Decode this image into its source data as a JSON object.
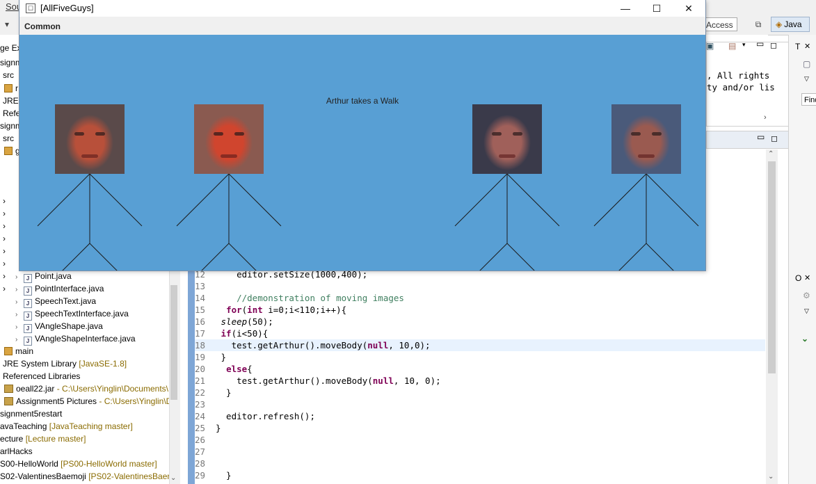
{
  "ide": {
    "menu_fragment": "Sou",
    "quick_access": "Access",
    "perspective": "Java",
    "find_box": "Find",
    "copyright_line1": ", All rights",
    "copyright_line2": "ty and/or lis"
  },
  "explorer": {
    "rows": [
      {
        "label": "ge Exp",
        "extra": ""
      },
      {
        "label": "signm",
        "extra": ""
      },
      {
        "label": "src",
        "extra": ""
      },
      {
        "label": "r",
        "extra": ""
      },
      {
        "label": "JRE S",
        "extra": ""
      },
      {
        "label": "Refe",
        "extra": ""
      },
      {
        "label": "signm",
        "extra": ""
      },
      {
        "label": "src",
        "extra": ""
      },
      {
        "label": "g",
        "extra": ""
      },
      {
        "label": "Point.java",
        "extra": ""
      },
      {
        "label": "PointInterface.java",
        "extra": ""
      },
      {
        "label": "SpeechText.java",
        "extra": ""
      },
      {
        "label": "SpeechTextInterface.java",
        "extra": ""
      },
      {
        "label": "VAngleShape.java",
        "extra": ""
      },
      {
        "label": "VAngleShapeInterface.java",
        "extra": ""
      },
      {
        "label": "main",
        "extra": ""
      },
      {
        "label": "JRE System Library",
        "extra": "[JavaSE-1.8]"
      },
      {
        "label": "Referenced Libraries",
        "extra": ""
      },
      {
        "label": "oeall22.jar",
        "extra": "- C:\\Users\\Yinglin\\Documents\\"
      },
      {
        "label": "Assignment5 Pictures",
        "extra": "- C:\\Users\\Yinglin\\D"
      },
      {
        "label": "signment5restart",
        "extra": ""
      },
      {
        "label": "avaTeaching",
        "extra": "[JavaTeaching master]"
      },
      {
        "label": "ecture",
        "extra": "[Lecture master]"
      },
      {
        "label": "arlHacks",
        "extra": ""
      },
      {
        "label": "S00-HelloWorld",
        "extra": "[PS00-HelloWorld master]"
      },
      {
        "label": "S02-ValentinesBaemoji",
        "extra": "[PS02-ValentinesBaem"
      }
    ]
  },
  "editor": {
    "lines": [
      {
        "num": "12",
        "text": "    editor.setSize(1000,400);"
      },
      {
        "num": "13",
        "text": ""
      },
      {
        "num": "14",
        "text": "    //demonstration of moving images"
      },
      {
        "num": "15",
        "text": "  for(int i=0;i<110;i++){"
      },
      {
        "num": "16",
        "text": " sleep(50);"
      },
      {
        "num": "17",
        "text": " if(i<50){"
      },
      {
        "num": "18",
        "text": "   test.getArthur().moveBody(null, 10,0);"
      },
      {
        "num": "19",
        "text": " }"
      },
      {
        "num": "20",
        "text": "  else{"
      },
      {
        "num": "21",
        "text": "    test.getArthur().moveBody(null, 10, 0);"
      },
      {
        "num": "22",
        "text": "  }"
      },
      {
        "num": "23",
        "text": ""
      },
      {
        "num": "24",
        "text": "  editor.refresh();"
      },
      {
        "num": "25",
        "text": "}"
      },
      {
        "num": "26",
        "text": ""
      },
      {
        "num": "27",
        "text": ""
      },
      {
        "num": "28",
        "text": ""
      },
      {
        "num": "29",
        "text": "  }"
      }
    ]
  },
  "app_window": {
    "title": "[AllFiveGuys]",
    "menu_label": "Common",
    "scene_title": "Arthur takes a Walk",
    "minimize_glyph": "—",
    "maximize_glyph": "☐",
    "close_glyph": "✕",
    "canvas_color": "#589fd4",
    "characters": [
      {
        "name": "face-1",
        "skin": "#b8503a",
        "hair": "#5a4a4a"
      },
      {
        "name": "face-2",
        "skin": "#d0452e",
        "hair": "#8a5a50"
      },
      {
        "name": "face-3",
        "skin": "#a0605a",
        "hair": "#3a3a4a"
      },
      {
        "name": "face-4",
        "skin": "#9a5a50",
        "hair": "#4a5a7a"
      }
    ]
  },
  "right_panels": {
    "tab_t": "T",
    "tab_o": "O"
  }
}
